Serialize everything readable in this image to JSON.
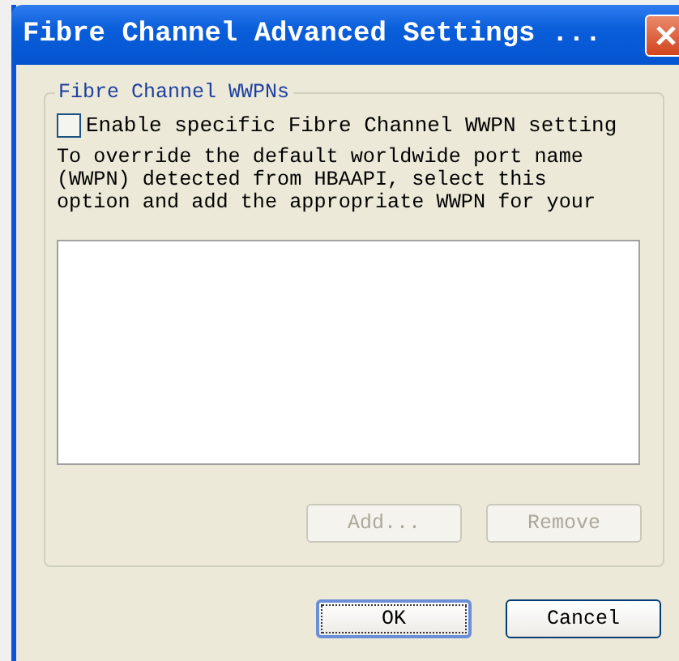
{
  "window": {
    "title": "Fibre Channel Advanced Settings ..."
  },
  "group": {
    "title": "Fibre Channel WWPNs",
    "checkbox": {
      "label": "Enable specific Fibre Channel WWPN setting",
      "checked": false
    },
    "description": [
      "To override the default worldwide port name",
      "(WWPN) detected from HBAAPI, select this",
      "option and add the appropriate WWPN for your"
    ],
    "buttons": [
      {
        "label": "Add...",
        "disabled": true
      },
      {
        "label": "Remove",
        "disabled": true
      }
    ]
  },
  "buttons": [
    {
      "label": "OK",
      "default": true
    },
    {
      "label": "Cancel",
      "default": false
    }
  ]
}
